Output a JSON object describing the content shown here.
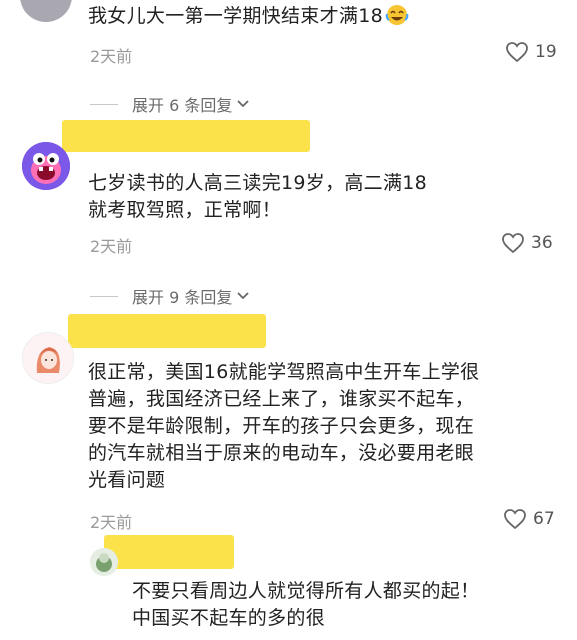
{
  "comments": [
    {
      "text": "我女儿大一第一学期快结束才满18",
      "time": "2天前",
      "likes": "19"
    },
    {
      "text_lines": [
        "七岁读书的人高三读完19岁，高二满18",
        "就考取驾照，正常啊！"
      ],
      "time": "2天前",
      "likes": "36"
    },
    {
      "text_lines": [
        "很正常，美国16就能学驾照高中生开车上学很",
        "普遍，我国经济已经上来了，谁家买不起车，",
        "要不是年龄限制，开车的孩子只会更多，现在",
        "的汽车就相当于原来的电动车，没必要用老眼",
        "光看问题"
      ],
      "time": "2天前",
      "likes": "67"
    }
  ],
  "reply": {
    "text_lines": [
      "不要只看周边人就觉得所有人都买的起！",
      "中国买不起车的多的很"
    ]
  },
  "expand": [
    {
      "label": "展开 6 条回复"
    },
    {
      "label": "展开 9 条回复"
    }
  ],
  "colors": {
    "redaction": "#fbe14a",
    "meta": "#9a9a9a"
  }
}
